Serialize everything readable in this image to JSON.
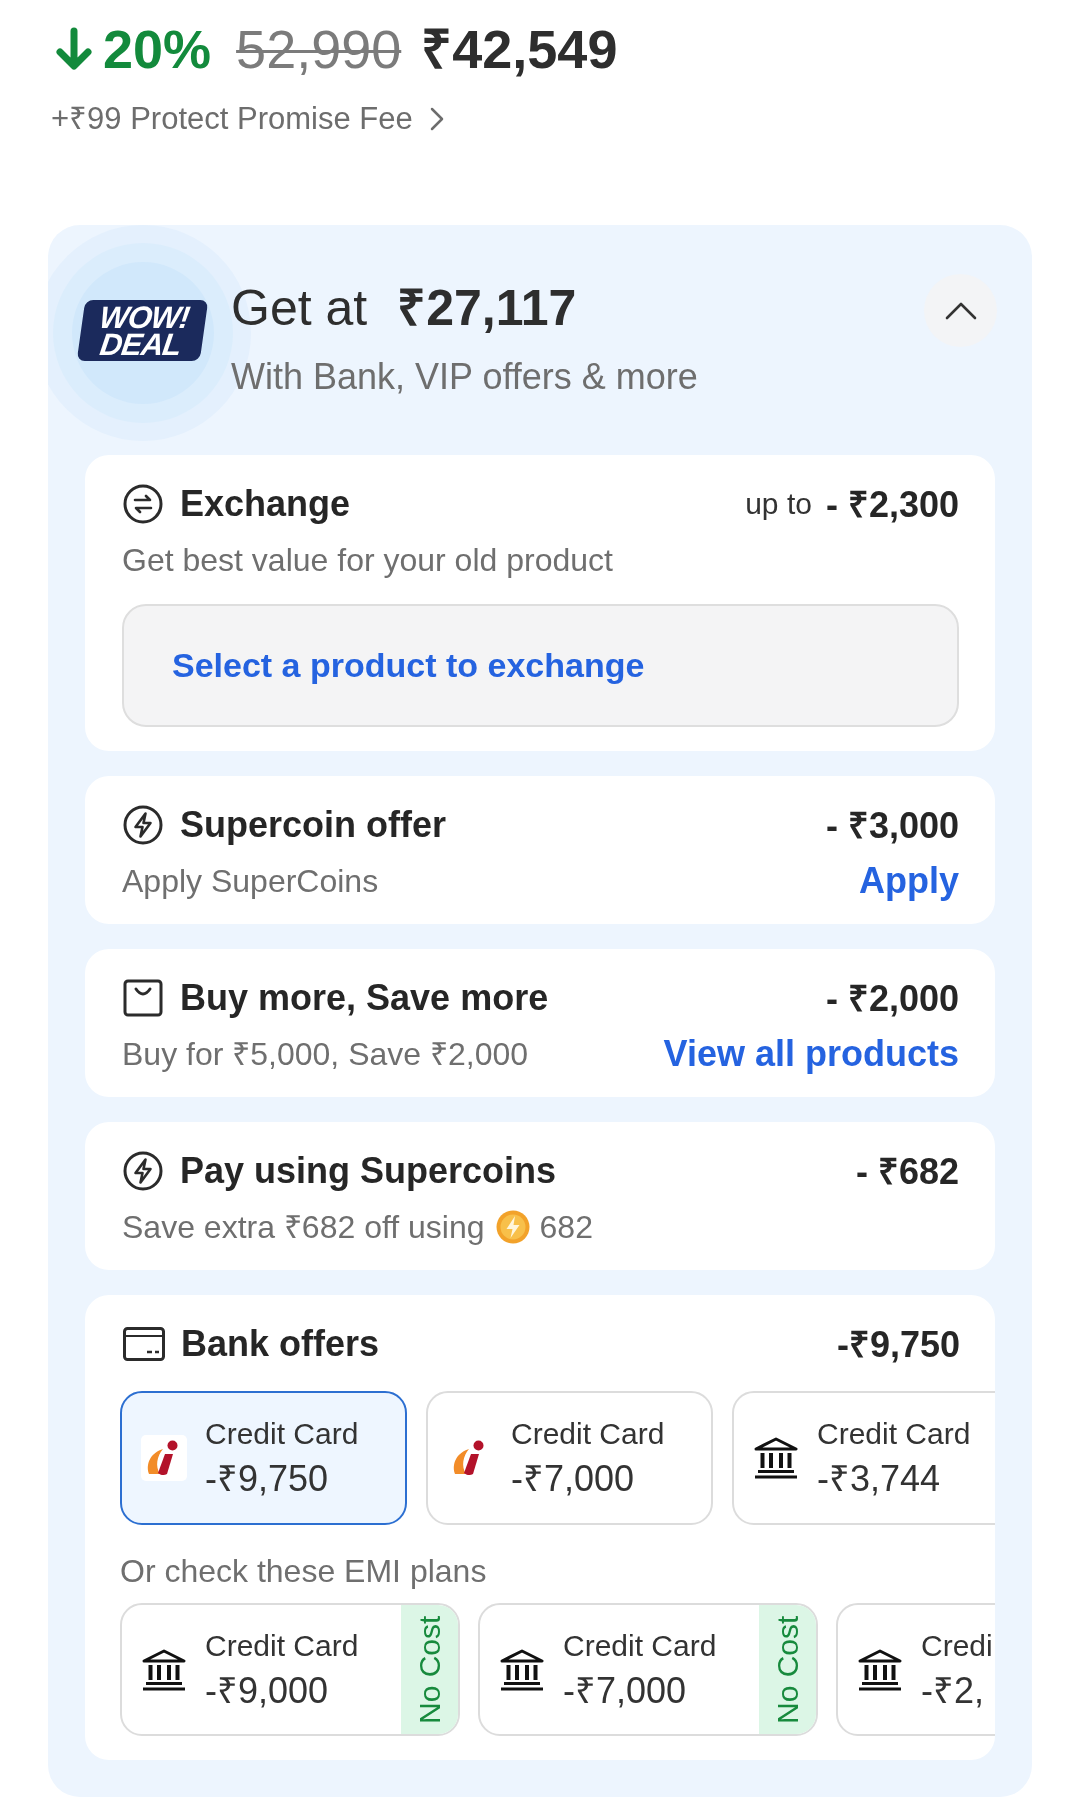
{
  "price": {
    "discount": "20%",
    "original": "52,990",
    "final": "₹42,549",
    "fee_link": "+₹99 Protect Promise Fee"
  },
  "deal": {
    "logo": [
      "WOW!",
      "DEAL"
    ],
    "title": "Get at",
    "price": "₹27,117",
    "subtitle": "With Bank, VIP offers & more",
    "expanded": true,
    "offers": [
      {
        "kind": "exchange",
        "title": "Exchange",
        "amount_prefix": "up to",
        "amount": "- ₹2,300",
        "subtitle": "Get best value for your old product",
        "button": "Select a product to exchange"
      },
      {
        "kind": "supercoin",
        "title": "Supercoin offer",
        "amount": "- ₹3,000",
        "subtitle": "Apply SuperCoins",
        "link": "Apply"
      },
      {
        "kind": "bundle",
        "title": "Buy more, Save more",
        "amount": "- ₹2,000",
        "subtitle": "Buy for ₹5,000, Save ₹2,000",
        "link": "View all products"
      },
      {
        "kind": "supercoin_pay",
        "title": "Pay using Supercoins",
        "amount": "- ₹682",
        "subtitle": "Save extra ₹682 off using",
        "coins": "682"
      }
    ],
    "bank_offers": {
      "title": "Bank offers",
      "amount": "-₹9,750",
      "cards": [
        {
          "kind": "branded",
          "label": "Credit Card",
          "amount": "-₹9,750",
          "selected": true
        },
        {
          "kind": "branded",
          "label": "Credit Card",
          "amount": "-₹7,000",
          "selected": false
        },
        {
          "kind": "bank",
          "label": "Credit Card",
          "amount": "-₹3,744",
          "selected": false
        }
      ],
      "emi_heading": "Or check these EMI plans",
      "emi_plans": [
        {
          "kind": "bank",
          "label": "Credit Card",
          "amount": "-₹9,000",
          "tag": "No Cost",
          "selected": false
        },
        {
          "kind": "bank",
          "label": "Credit Card",
          "amount": "-₹7,000",
          "tag": "No Cost",
          "selected": false
        },
        {
          "kind": "bank",
          "label": "Credi",
          "amount": "-₹2,",
          "selected": false
        }
      ]
    }
  }
}
